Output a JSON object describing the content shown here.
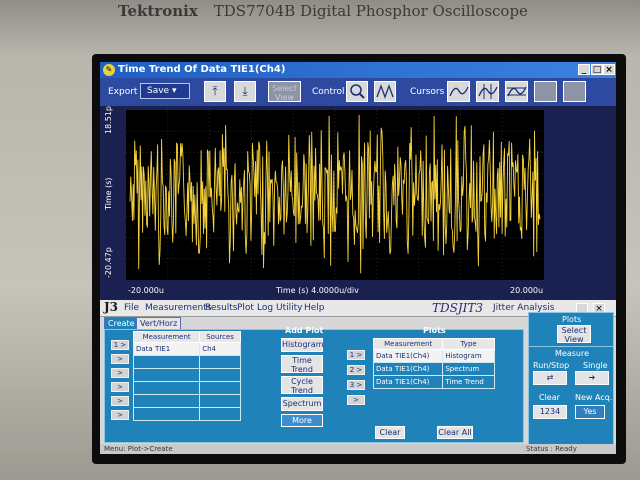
{
  "bezel": {
    "brand": "Tektronix",
    "model": "TDS7704B  Digital Phosphor Oscilloscope"
  },
  "window": {
    "title": "Time Trend Of Data TIE1(Ch4)"
  },
  "toolbar": {
    "export_label": "Export",
    "save_value": "Save",
    "select_view": "Select View",
    "control_label": "Control",
    "cursors_label": "Cursors"
  },
  "plot": {
    "y_top": "18.51p",
    "y_bottom": "-20.47p",
    "y_axis_label": "Time (s)",
    "x_left": "-20.000u",
    "x_center": "Time (s)  4.0000u/div",
    "x_right": "20.000u",
    "trace_color": "#f5d33a"
  },
  "chart_data": {
    "type": "line",
    "xlabel": "Time (s)",
    "ylabel": "Time (s)",
    "xlim": [
      "-20.000u",
      "20.000u"
    ],
    "ylim": [
      "-20.47p",
      "18.51p"
    ],
    "grid": true,
    "x_per_div": "4.0000u/div"
  },
  "app": {
    "logo": "J3",
    "menus": [
      "File",
      "Measurements",
      "Results",
      "Plot",
      "Log",
      "Utility",
      "Help"
    ],
    "product": "TDSJIT3",
    "product_sub": "Jitter Analysis",
    "tabs": [
      "Create",
      "Vert/Horz Axis"
    ],
    "meas_table": {
      "headers": [
        "Measurement",
        "Sources"
      ],
      "rows": [
        [
          "Data TIE1",
          "Ch4"
        ],
        [
          "",
          ""
        ],
        [
          "",
          ""
        ],
        [
          "",
          ""
        ],
        [
          "",
          ""
        ],
        [
          "",
          ""
        ]
      ]
    },
    "side_rows": [
      "1 >",
      ">",
      ">",
      ">",
      ">",
      ">"
    ],
    "add_plot": {
      "title": "Add Plot",
      "buttons": [
        "Histogram",
        "Time Trend",
        "Cycle Trend",
        "Spectrum",
        "More"
      ]
    },
    "plots": {
      "title": "Plots",
      "headers": [
        "Measurement",
        "Type"
      ],
      "rows": [
        [
          "Data TIE1(Ch4)",
          "Histogram"
        ],
        [
          "Data TIE1(Ch4)",
          "Spectrum"
        ],
        [
          "Data TIE1(Ch4)",
          "Time Trend"
        ]
      ],
      "row_buttons": [
        "1 >",
        "2 >",
        "3 >",
        ">"
      ],
      "clear": "Clear",
      "clear_all": "Clear All"
    },
    "right": {
      "plots_label": "Plots",
      "select_view": "Select View",
      "measure_label": "Measure",
      "run_stop": "Run/Stop",
      "single": "Single",
      "clear": "Clear",
      "new_acq": "New Acq.",
      "yes": "Yes",
      "counter": "1234"
    },
    "status_menu": "Menu: Plot->Create",
    "status_right": "Status : Ready"
  }
}
